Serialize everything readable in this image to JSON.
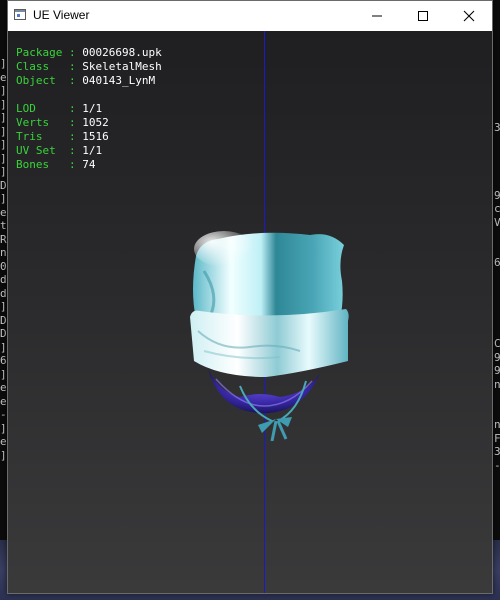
{
  "window": {
    "title": "UE Viewer",
    "controls": {
      "minimize_icon": "minimize-icon",
      "maximize_icon": "maximize-icon",
      "close_icon": "close-icon"
    }
  },
  "info": {
    "object_rows": [
      {
        "label": "Package",
        "value": "00026698.upk"
      },
      {
        "label": "Class  ",
        "value": "SkeletalMesh"
      },
      {
        "label": "Object ",
        "value": "040143_LynM"
      }
    ],
    "mesh_rows": [
      {
        "label": "LOD    ",
        "value": "1/1"
      },
      {
        "label": "Verts  ",
        "value": "1052"
      },
      {
        "label": "Tris   ",
        "value": "1516"
      },
      {
        "label": "UV Set ",
        "value": "1/1"
      },
      {
        "label": "Bones  ",
        "value": "74"
      }
    ],
    "separator": " : "
  },
  "background_console": {
    "left_chars": [
      "]",
      "e",
      "]",
      "]",
      "]",
      "]",
      "]",
      "]",
      "]",
      "D",
      "]",
      "e",
      "t",
      "R",
      "n",
      "0",
      "d",
      "d",
      "]",
      "D",
      "D",
      "]",
      "6",
      "]",
      "e",
      "e",
      "-",
      "]",
      "e",
      "]"
    ],
    "right_chars": [
      "3",
      "",
      "",
      "",
      "",
      "9",
      "c",
      "V",
      "",
      "",
      "6",
      "",
      "",
      "",
      "",
      "",
      "C",
      "9",
      "9",
      "n",
      "",
      "",
      "n",
      "F",
      "3",
      "-"
    ]
  },
  "colors": {
    "label_green": "#3ad33a",
    "value_white": "#ffffff",
    "axis_blue": "#1a1acc",
    "mesh_cyan": "#9fe8f0"
  }
}
